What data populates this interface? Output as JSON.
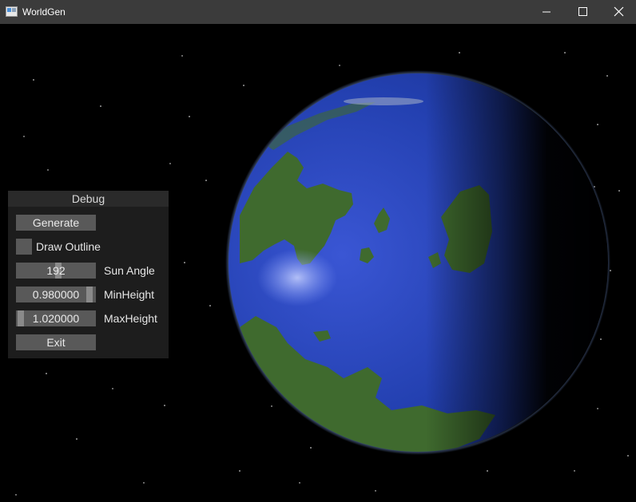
{
  "window": {
    "title": "WorldGen"
  },
  "debug": {
    "header": "Debug",
    "generate_label": "Generate",
    "draw_outline_label": "Draw Outline",
    "draw_outline_checked": false,
    "sun_angle": {
      "value": "192",
      "label": "Sun Angle",
      "fraction": 0.53
    },
    "min_height": {
      "value": "0.980000",
      "label": "MinHeight",
      "fraction": 0.96
    },
    "max_height": {
      "value": "1.020000",
      "label": "MaxHeight",
      "fraction": 0.02
    },
    "exit_label": "Exit"
  },
  "colors": {
    "titlebar": "#3b3b3b",
    "panel_bg": "#1f1f1f",
    "widget": "#595959",
    "ocean": "#1e3fa8",
    "land": "#3f6a2e"
  }
}
